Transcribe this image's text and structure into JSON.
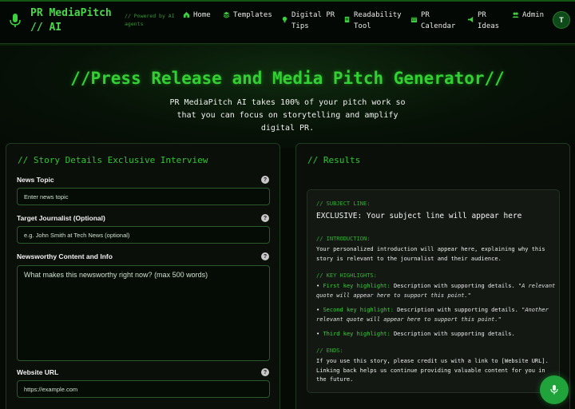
{
  "brand": {
    "title": "PR MediaPitch // AI",
    "tagline": "// Powered by AI agents"
  },
  "nav": {
    "items": [
      {
        "label": "Home",
        "icon": "home-icon"
      },
      {
        "label": "Templates",
        "icon": "layers-icon"
      },
      {
        "label": "Digital PR Tips",
        "icon": "lightbulb-icon"
      },
      {
        "label": "Readability Tool",
        "icon": "document-icon"
      },
      {
        "label": "PR Calendar",
        "icon": "calendar-icon"
      },
      {
        "label": "PR Ideas",
        "icon": "megaphone-icon"
      },
      {
        "label": "Admin",
        "icon": "users-icon"
      }
    ],
    "avatar": "T"
  },
  "hero": {
    "title": "//Press Release and Media Pitch Generator//",
    "subtitle": "PR MediaPitch AI takes 100% of your pitch work so that you can focus on storytelling and amplify digital PR."
  },
  "form": {
    "title": "// Story Details Exclusive Interview",
    "news_topic": {
      "label": "News Topic",
      "placeholder": "Enter news topic"
    },
    "journalist": {
      "label": "Target Journalist (Optional)",
      "placeholder": "e.g. John Smith at Tech News (optional)"
    },
    "content": {
      "label": "Newsworthy Content and Info",
      "placeholder": "What makes this newsworthy right now? (max 500 words)"
    },
    "website": {
      "label": "Website URL",
      "placeholder": "https://example.com"
    }
  },
  "results": {
    "title": "// Results",
    "subject_label": "// SUBJECT LINE:",
    "subject": "EXCLUSIVE: Your subject line will appear here",
    "intro_label": "// INTRODUCTION:",
    "intro": "Your personalized introduction will appear here, explaining why this story is relevant to the journalist and their audience.",
    "highlights_label": "// KEY HIGHLIGHTS:",
    "highlights": [
      {
        "title": "First key highlight:",
        "text": "Description with supporting details.",
        "quote": "\"A relevant quote will appear here to support this point.\""
      },
      {
        "title": "Second key highlight:",
        "text": "Description with supporting details.",
        "quote": "\"Another relevant quote will appear here to support this point.\""
      },
      {
        "title": "Third key highlight:",
        "text": "Description with supporting details.",
        "quote": ""
      }
    ],
    "ends_label": "// ENDS:",
    "ends": "If you use this story, please credit us with a link to [Website URL]. Linking back helps us continue providing valuable content for you in the future."
  },
  "colors": {
    "accent": "#33d033",
    "background": "#050a05",
    "panel": "#0a0f0a",
    "fab": "#1fa33a"
  }
}
